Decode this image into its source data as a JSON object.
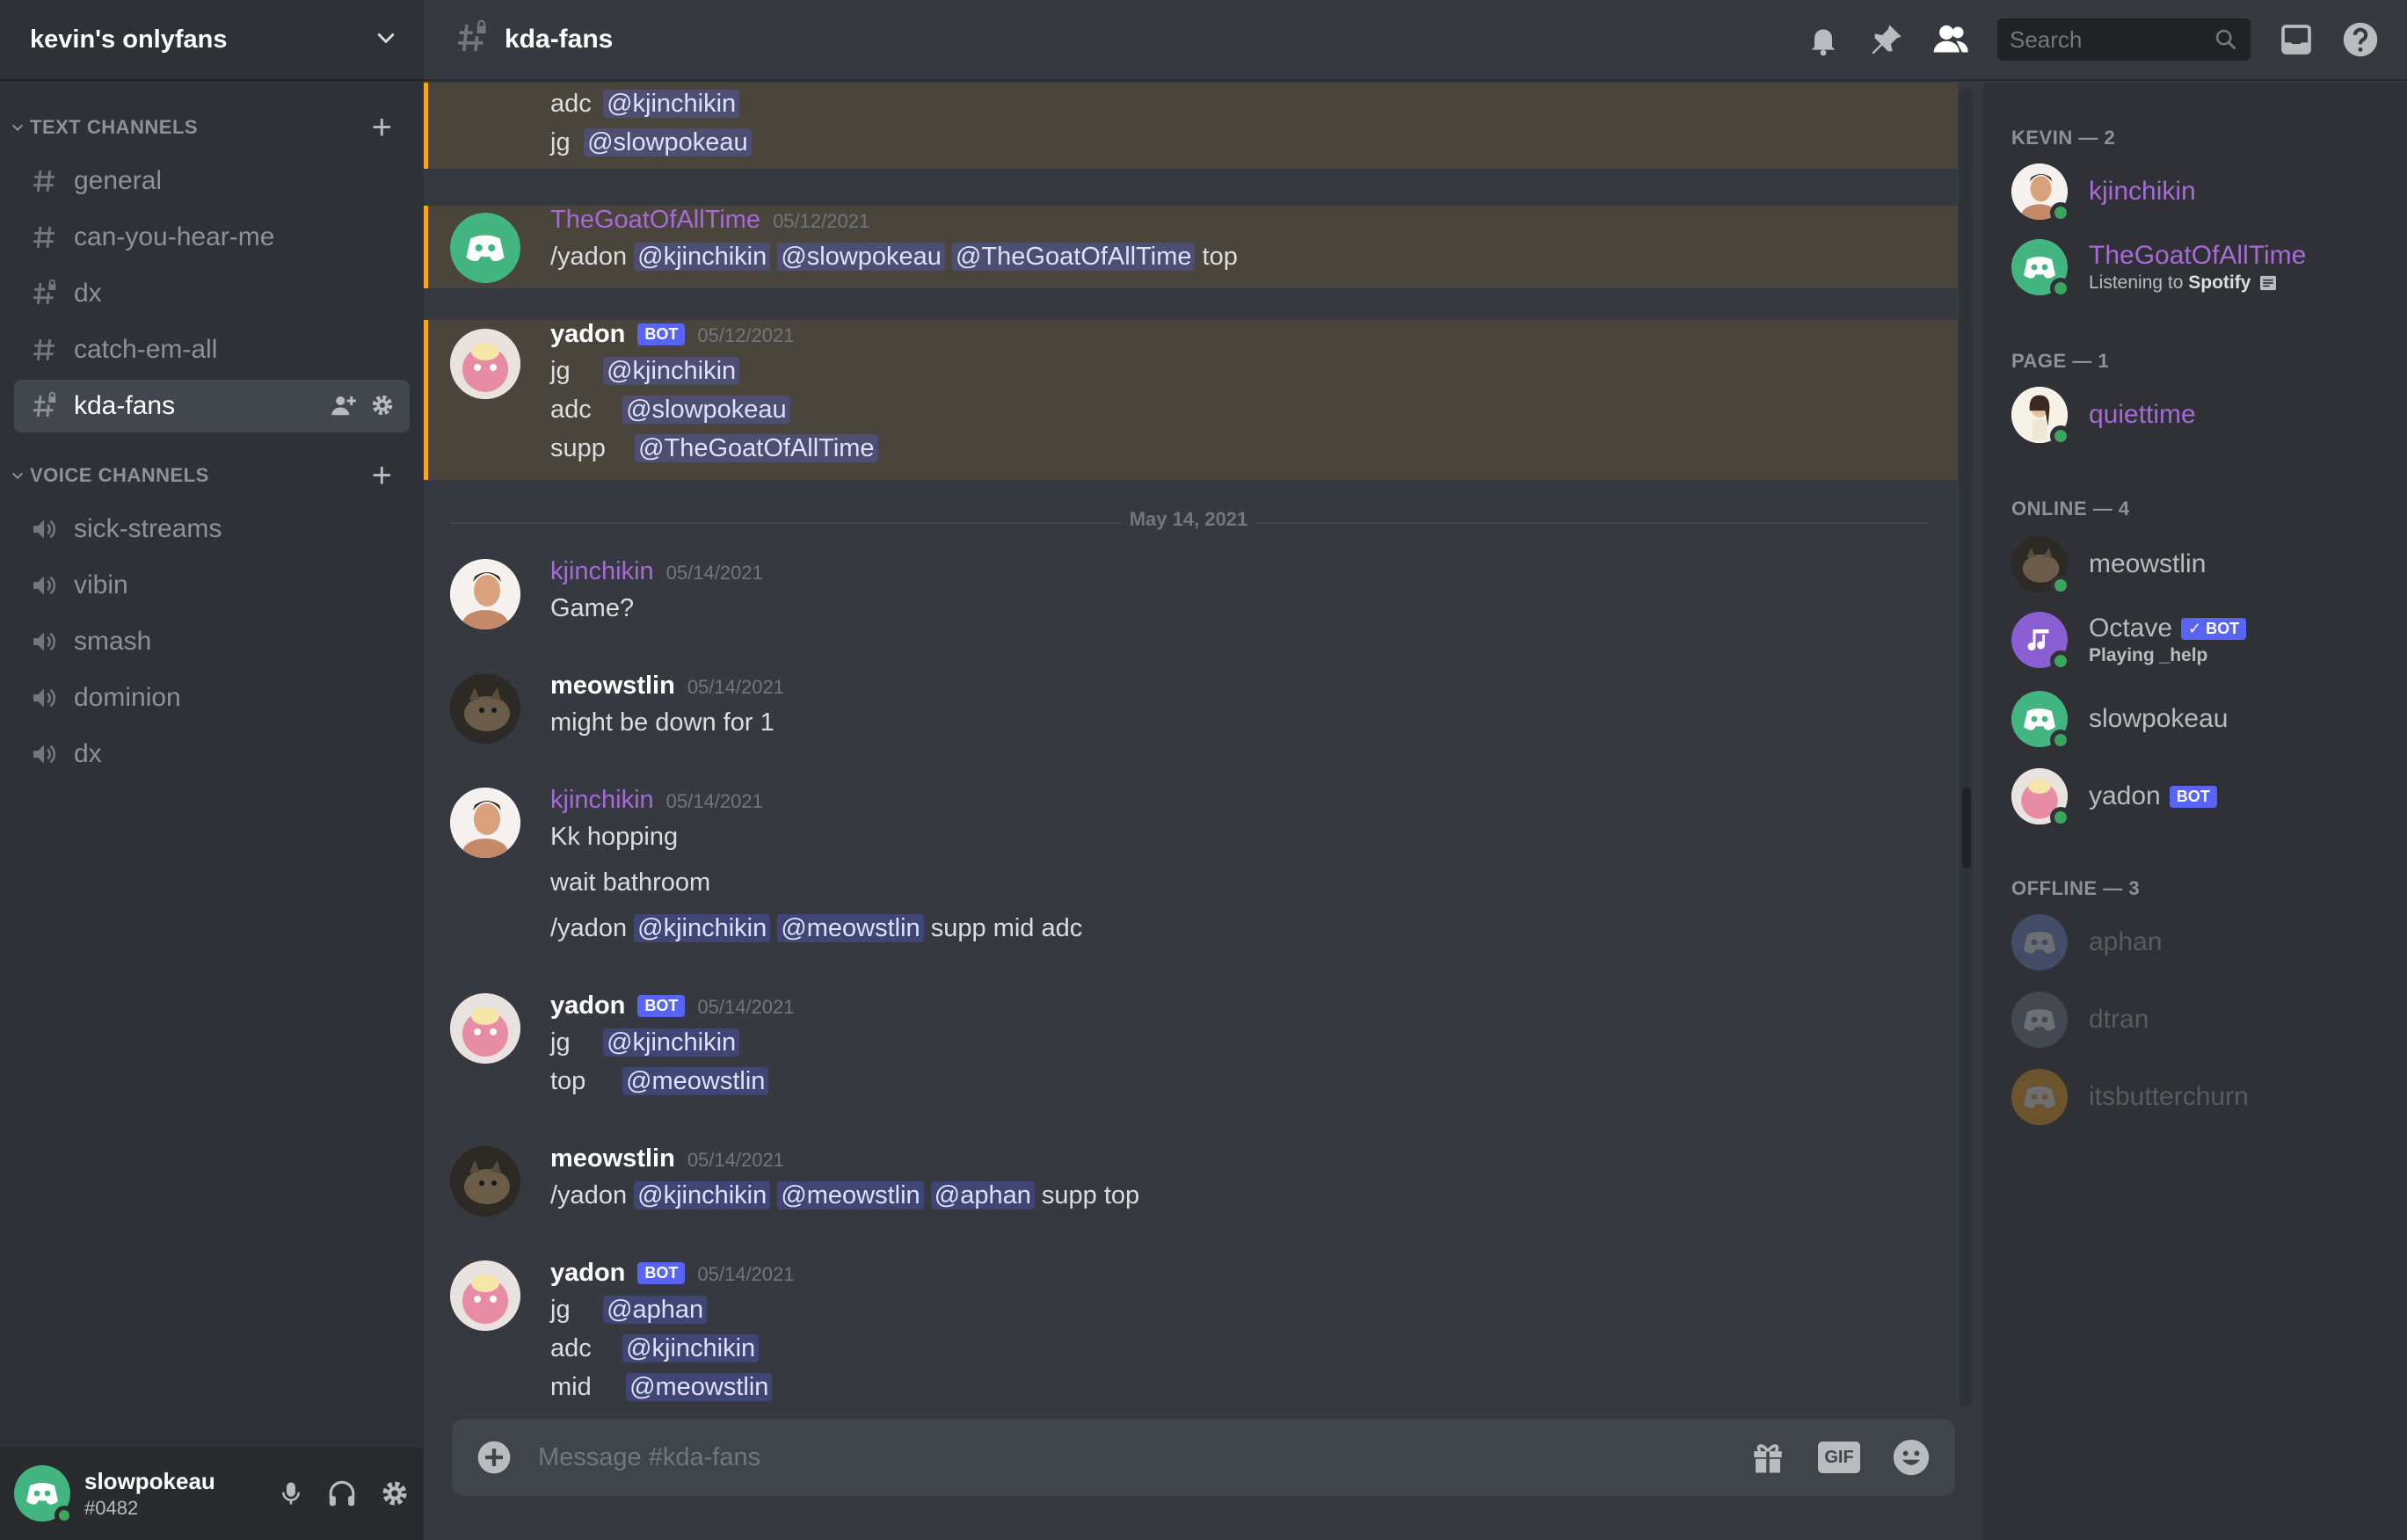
{
  "server": {
    "name": "kevin's onlyfans"
  },
  "sidebar": {
    "text_category": "TEXT CHANNELS",
    "voice_category": "VOICE CHANNELS",
    "text_channels": [
      {
        "name": "general"
      },
      {
        "name": "can-you-hear-me"
      },
      {
        "name": "dx"
      },
      {
        "name": "catch-em-all"
      },
      {
        "name": "kda-fans"
      }
    ],
    "voice_channels": [
      {
        "name": "sick-streams"
      },
      {
        "name": "vibin"
      },
      {
        "name": "smash"
      },
      {
        "name": "dominion"
      },
      {
        "name": "dx"
      }
    ]
  },
  "user": {
    "name": "slowpokeau",
    "tag": "#0482"
  },
  "topbar": {
    "channel": "kda-fans",
    "search_placeholder": "Search"
  },
  "composer": {
    "placeholder": "Message #kda-fans",
    "gif": "GIF"
  },
  "chat": {
    "top_partial": [
      {
        "role": "adc",
        "mention": "@kjinchikin"
      },
      {
        "role": "jg",
        "mention": "@slowpokeau"
      }
    ],
    "divider": "May 14, 2021",
    "bot_label": "BOT",
    "messages": [
      {
        "author": "TheGoatOfAllTime",
        "time": "05/12/2021",
        "text_prefix": "/yadon",
        "mentions": [
          "@kjinchikin",
          "@slowpokeau",
          "@TheGoatOfAllTime"
        ],
        "text_suffix": "top"
      },
      {
        "author": "yadon",
        "time": "05/12/2021",
        "lines": [
          {
            "role": "jg",
            "mention": "@kjinchikin"
          },
          {
            "role": "adc",
            "mention": "@slowpokeau"
          },
          {
            "role": "supp",
            "mention": "@TheGoatOfAllTime"
          }
        ]
      },
      {
        "author": "kjinchikin",
        "time": "05/14/2021",
        "text": "Game?"
      },
      {
        "author": "meowstlin",
        "time": "05/14/2021",
        "text": "might be down for 1"
      },
      {
        "author": "kjinchikin",
        "time": "05/14/2021",
        "line1": "Kk hopping",
        "line2": "wait bathroom",
        "text_prefix": "/yadon",
        "mentions": [
          "@kjinchikin",
          "@meowstlin"
        ],
        "text_suffix": "supp mid adc"
      },
      {
        "author": "yadon",
        "time": "05/14/2021",
        "lines": [
          {
            "role": "jg",
            "mention": "@kjinchikin"
          },
          {
            "role": "top",
            "mention": "@meowstlin"
          }
        ]
      },
      {
        "author": "meowstlin",
        "time": "05/14/2021",
        "text_prefix": "/yadon",
        "mentions": [
          "@kjinchikin",
          "@meowstlin",
          "@aphan"
        ],
        "text_suffix": "supp top"
      },
      {
        "author": "yadon",
        "time": "05/14/2021",
        "lines": [
          {
            "role": "jg",
            "mention": "@aphan"
          },
          {
            "role": "adc",
            "mention": "@kjinchikin"
          },
          {
            "role": "mid",
            "mention": "@meowstlin"
          }
        ]
      }
    ]
  },
  "members": {
    "groups": [
      {
        "title": "KEVIN — 2"
      },
      {
        "title": "PAGE — 1"
      },
      {
        "title": "ONLINE — 4"
      },
      {
        "title": "OFFLINE — 3"
      }
    ],
    "list": [
      {
        "name": "kjinchikin"
      },
      {
        "name": "TheGoatOfAllTime",
        "activity_prefix": "Listening to",
        "activity_bold": "Spotify"
      },
      {
        "name": "quiettime"
      },
      {
        "name": "meowstlin"
      },
      {
        "name": "Octave",
        "badge": "✓ BOT",
        "activity": "Playing _help"
      },
      {
        "name": "slowpokeau"
      },
      {
        "name": "yadon",
        "badge": "BOT"
      },
      {
        "name": "aphan"
      },
      {
        "name": "dtran"
      },
      {
        "name": "itsbutterchurn"
      }
    ]
  },
  "colors": {
    "accent": "#5865f2",
    "highlight_border": "#faa61a",
    "online": "#3ba55d",
    "role_purple": "#a66bd6"
  }
}
